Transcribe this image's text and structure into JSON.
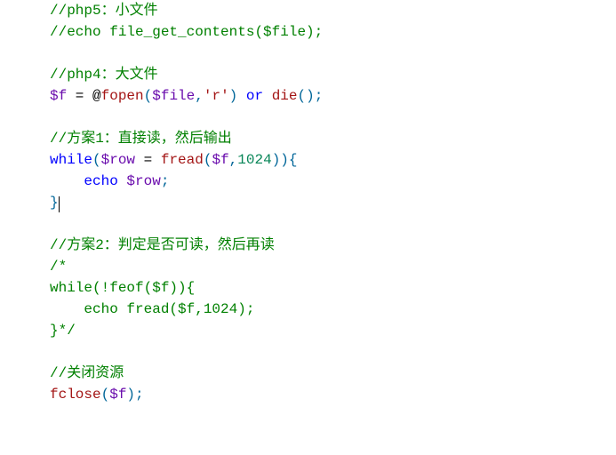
{
  "code": {
    "lines": [
      {
        "type": "comment",
        "text": "//php5：小文件"
      },
      {
        "type": "comment",
        "text": "//echo file_get_contents($file);"
      },
      {
        "type": "blank",
        "text": ""
      },
      {
        "type": "comment",
        "text": "//php4：大文件"
      },
      {
        "type": "mixed",
        "tokens": [
          {
            "cls": "tok-var",
            "t": "$f"
          },
          {
            "cls": "tok-op",
            "t": " = @"
          },
          {
            "cls": "tok-func",
            "t": "fopen"
          },
          {
            "cls": "tok-punct",
            "t": "("
          },
          {
            "cls": "tok-var",
            "t": "$file"
          },
          {
            "cls": "tok-punct",
            "t": ","
          },
          {
            "cls": "tok-str",
            "t": "'r'"
          },
          {
            "cls": "tok-punct",
            "t": ")"
          },
          {
            "cls": "tok-op",
            "t": " "
          },
          {
            "cls": "tok-keyword",
            "t": "or"
          },
          {
            "cls": "tok-op",
            "t": " "
          },
          {
            "cls": "tok-func",
            "t": "die"
          },
          {
            "cls": "tok-punct",
            "t": "();"
          }
        ]
      },
      {
        "type": "blank",
        "text": ""
      },
      {
        "type": "comment",
        "text": "//方案1：直接读，然后输出"
      },
      {
        "type": "mixed",
        "tokens": [
          {
            "cls": "tok-keyword",
            "t": "while"
          },
          {
            "cls": "tok-punct",
            "t": "("
          },
          {
            "cls": "tok-var",
            "t": "$row"
          },
          {
            "cls": "tok-op",
            "t": " = "
          },
          {
            "cls": "tok-func",
            "t": "fread"
          },
          {
            "cls": "tok-punct",
            "t": "("
          },
          {
            "cls": "tok-var",
            "t": "$f"
          },
          {
            "cls": "tok-punct",
            "t": ","
          },
          {
            "cls": "tok-num",
            "t": "1024"
          },
          {
            "cls": "tok-punct",
            "t": ")){"
          }
        ]
      },
      {
        "type": "mixed",
        "tokens": [
          {
            "cls": "tok-op",
            "t": "    "
          },
          {
            "cls": "tok-keyword",
            "t": "echo"
          },
          {
            "cls": "tok-op",
            "t": " "
          },
          {
            "cls": "tok-var",
            "t": "$row"
          },
          {
            "cls": "tok-punct",
            "t": ";"
          }
        ]
      },
      {
        "type": "mixed",
        "caret": true,
        "tokens": [
          {
            "cls": "tok-punct",
            "t": "}"
          }
        ]
      },
      {
        "type": "blank",
        "text": ""
      },
      {
        "type": "comment",
        "text": "//方案2：判定是否可读，然后再读"
      },
      {
        "type": "comment",
        "text": "/*"
      },
      {
        "type": "comment",
        "text": "while(!feof($f)){"
      },
      {
        "type": "comment",
        "text": "    echo fread($f,1024);"
      },
      {
        "type": "comment",
        "text": "}*/"
      },
      {
        "type": "blank",
        "text": ""
      },
      {
        "type": "comment",
        "text": "//关闭资源"
      },
      {
        "type": "mixed",
        "tokens": [
          {
            "cls": "tok-func",
            "t": "fclose"
          },
          {
            "cls": "tok-punct",
            "t": "("
          },
          {
            "cls": "tok-var",
            "t": "$f"
          },
          {
            "cls": "tok-punct",
            "t": ");"
          }
        ]
      }
    ]
  }
}
